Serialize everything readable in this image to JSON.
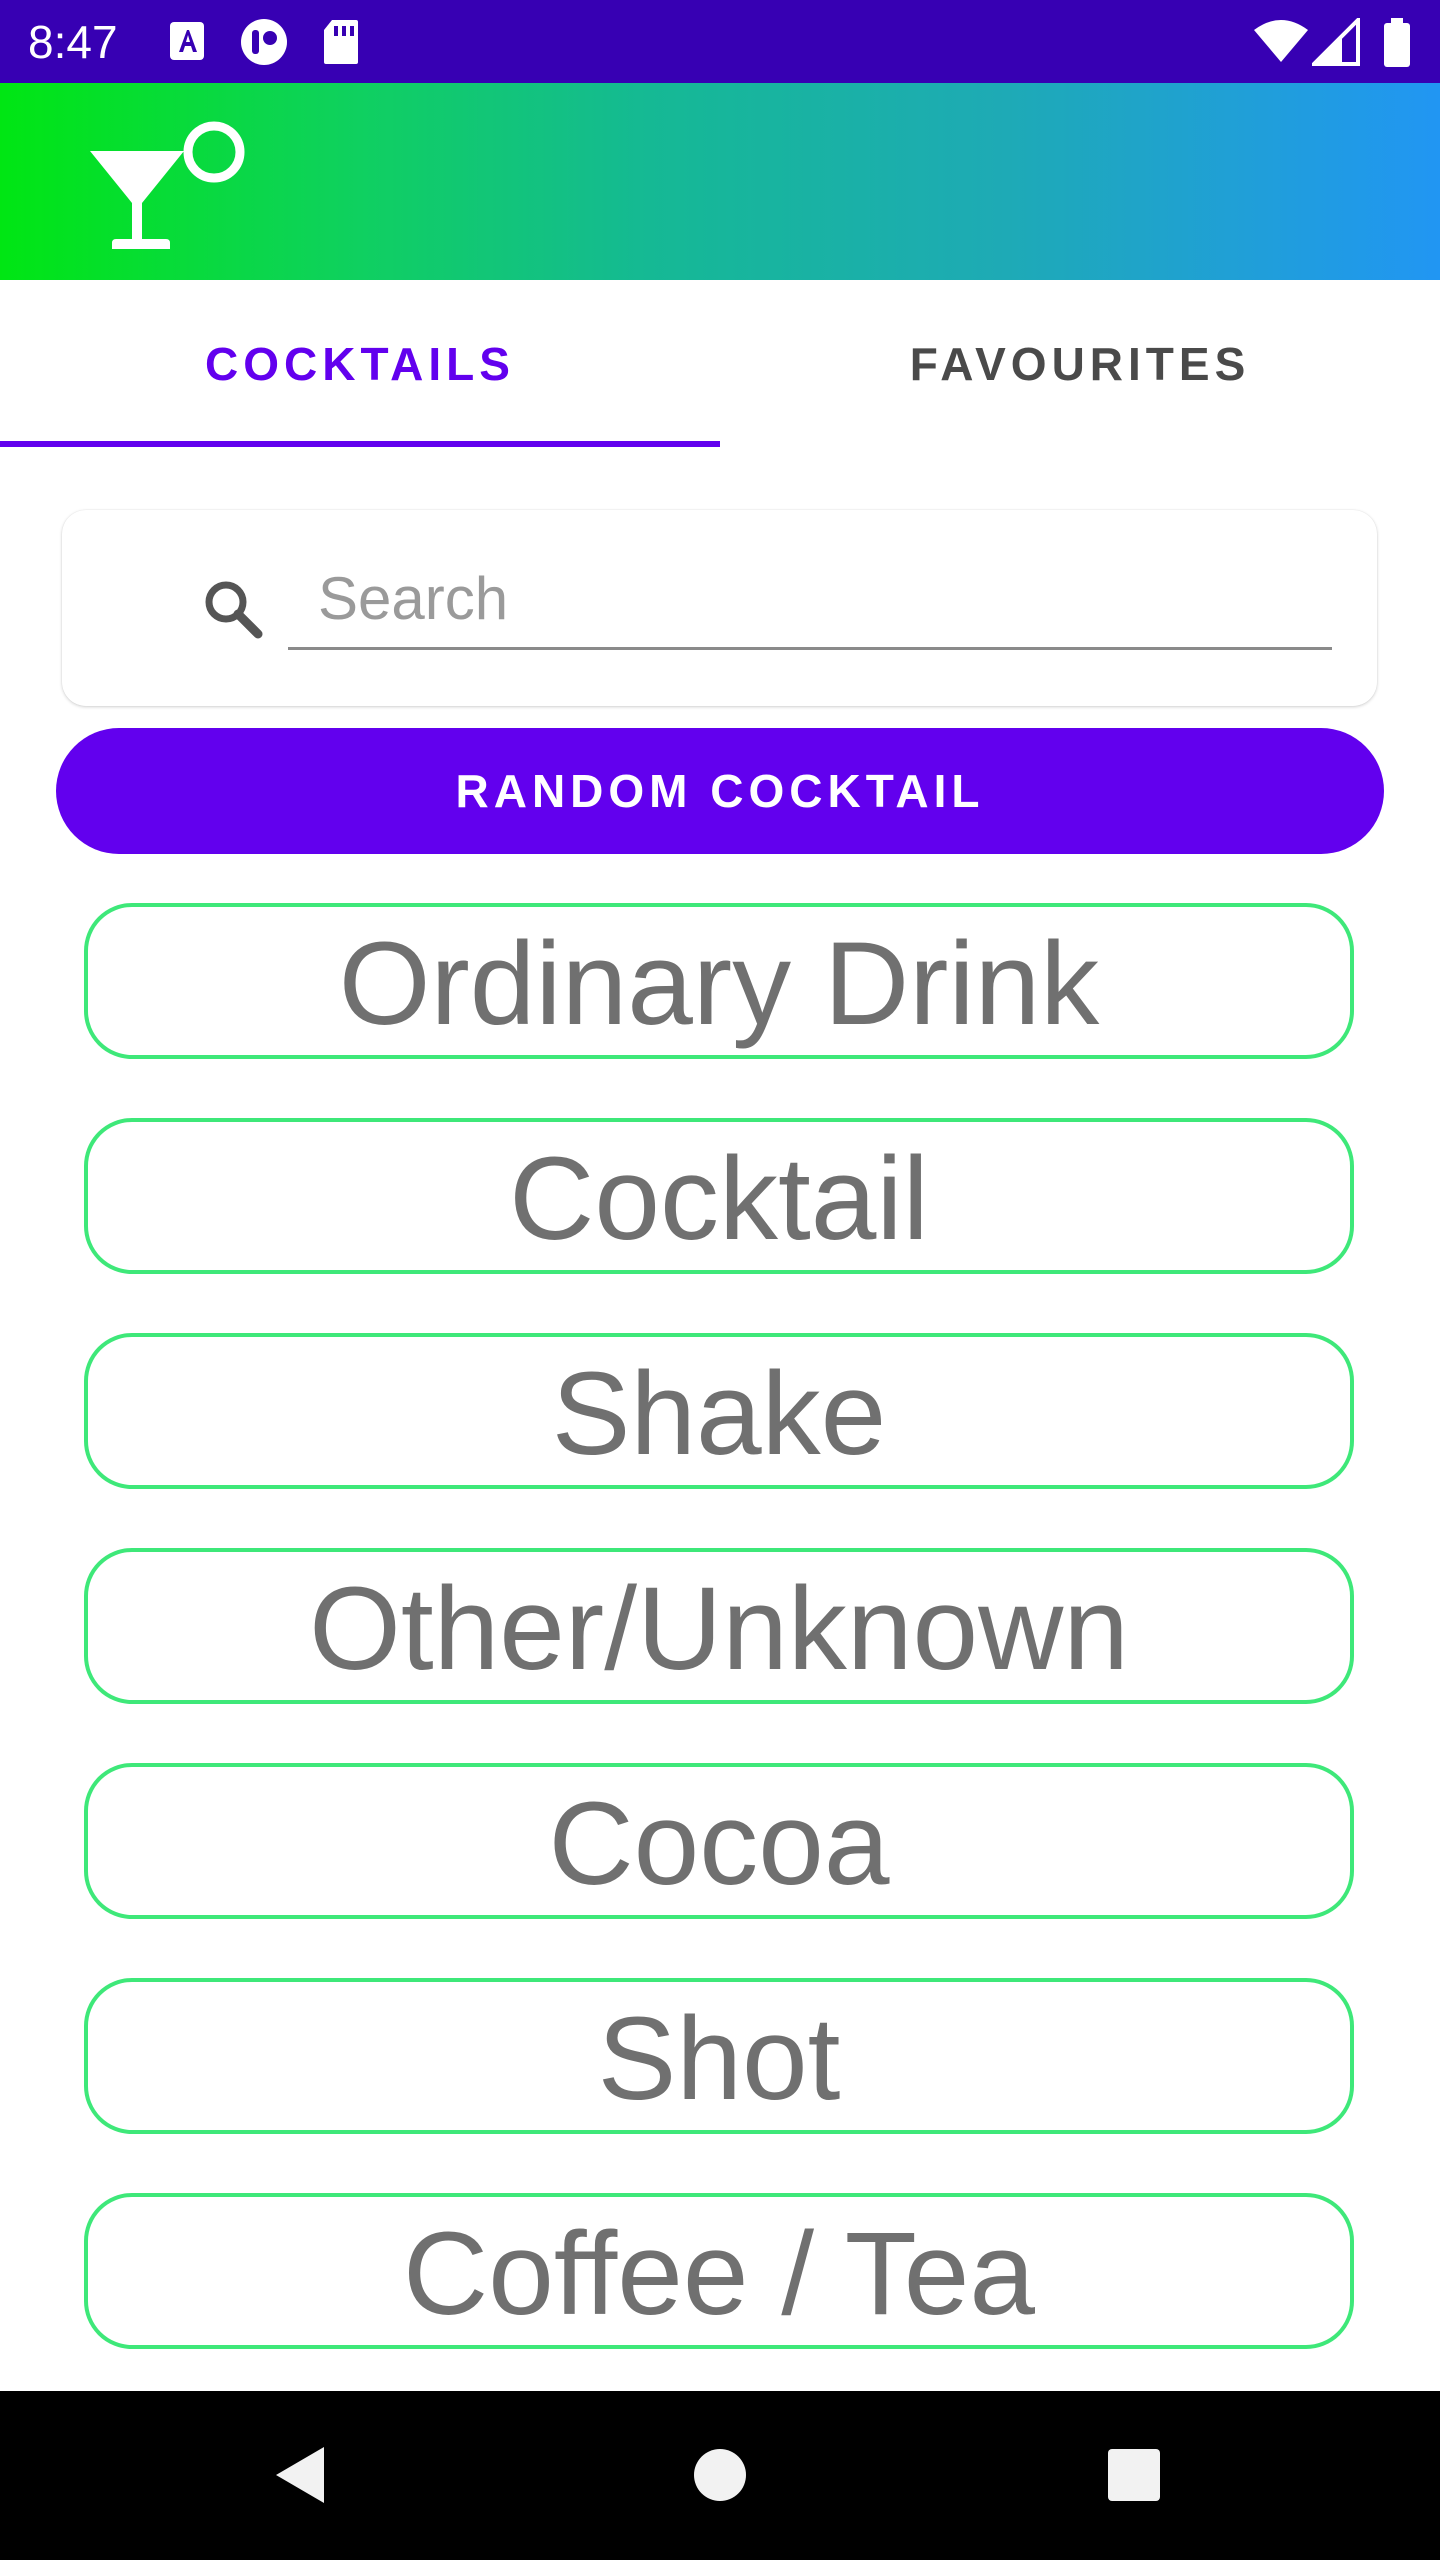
{
  "status_bar": {
    "time": "8:47",
    "icons": [
      "notification-a-icon",
      "notification-circle-icon",
      "sd-card-icon",
      "wifi-icon",
      "signal-icon",
      "battery-icon"
    ]
  },
  "app_bar": {
    "logo_icon": "cocktail-glass-icon",
    "gradient_colors": [
      "#00e613",
      "#15b994",
      "#2196f3"
    ]
  },
  "tabs": [
    {
      "label": "COCKTAILS",
      "selected": true
    },
    {
      "label": "FAVOURITES",
      "selected": false
    }
  ],
  "search": {
    "placeholder": "Search",
    "value": ""
  },
  "random_button": {
    "label": "RANDOM COCKTAIL"
  },
  "categories": [
    {
      "label": "Ordinary Drink"
    },
    {
      "label": "Cocktail"
    },
    {
      "label": "Shake"
    },
    {
      "label": "Other/Unknown"
    },
    {
      "label": "Cocoa"
    },
    {
      "label": "Shot"
    },
    {
      "label": "Coffee / Tea"
    }
  ],
  "nav_bar": {
    "icons": [
      "back-icon",
      "home-icon",
      "recents-icon"
    ]
  },
  "colors": {
    "status_bar": "#3700b3",
    "primary": "#6200ee",
    "category_border": "#3ee879",
    "category_text": "#707070"
  }
}
